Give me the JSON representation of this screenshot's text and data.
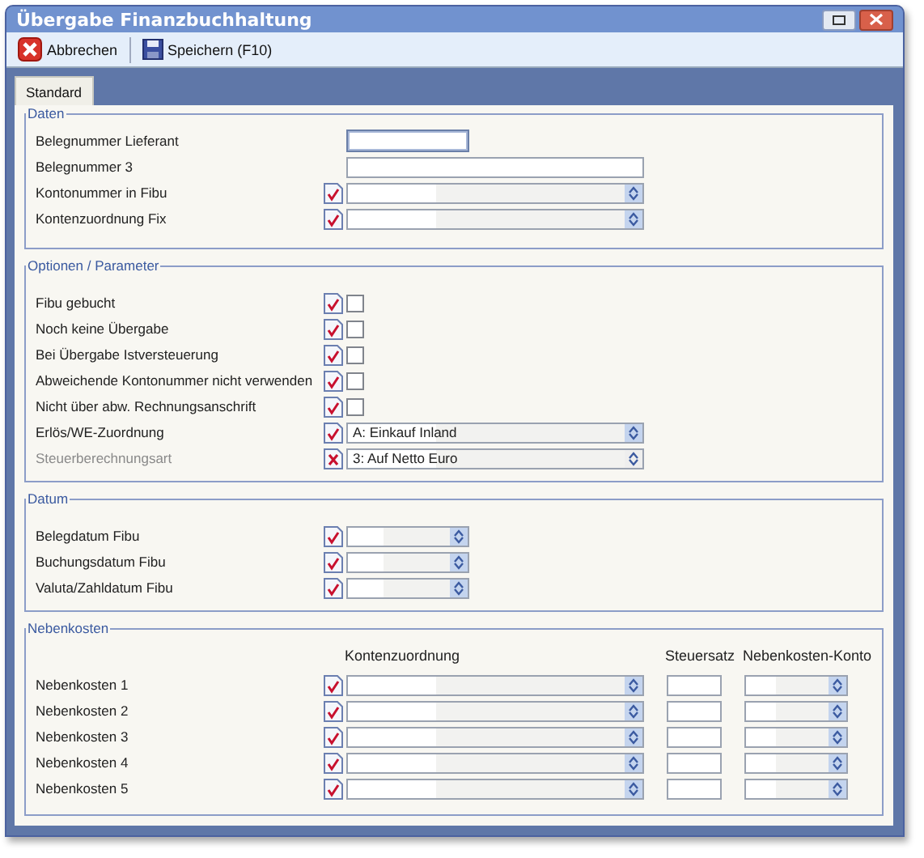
{
  "window": {
    "title": "Übergabe Finanzbuchhaltung"
  },
  "toolbar": [
    {
      "kind": "cancel",
      "label": "Abbrechen"
    },
    {
      "kind": "save",
      "label": "Speichern (F10)"
    }
  ],
  "tabs": [
    {
      "label": "Standard",
      "selected": true
    }
  ],
  "sections": [
    {
      "title": "Daten",
      "rows": [
        {
          "label": "Belegnummer Lieferant",
          "kind": "short-text",
          "focused": true
        },
        {
          "label": "Belegnummer 3",
          "kind": "text",
          "focused": false
        },
        {
          "label": "Kontonummer in Fibu",
          "kind": "combo",
          "valid": true
        },
        {
          "label": "Kontenzuordnung Fix",
          "kind": "combo",
          "valid": true
        }
      ]
    },
    {
      "title": "Optionen / Parameter",
      "rows": [
        {
          "label": "Fibu gebucht",
          "kind": "check",
          "valid": true,
          "checked": false
        },
        {
          "label": "Noch keine Übergabe",
          "kind": "check",
          "valid": true,
          "checked": false
        },
        {
          "label": "Bei Übergabe Istversteuerung",
          "kind": "check",
          "valid": true,
          "checked": false
        },
        {
          "label": "Abweichende Kontonummer nicht verwenden",
          "kind": "check",
          "valid": true,
          "checked": false
        },
        {
          "label": "Nicht über abw. Rechnungsanschrift",
          "kind": "check",
          "valid": true,
          "checked": false
        },
        {
          "label": "Erlös/WE-Zuordnung",
          "kind": "combo",
          "valid": true,
          "value": "A: Einkauf Inland",
          "disabled": false
        },
        {
          "label": "Steuerberechnungsart",
          "kind": "combo",
          "valid": false,
          "value": "3: Auf Netto Euro",
          "disabled": true
        }
      ]
    },
    {
      "title": "Datum",
      "rows": [
        {
          "label": "Belegdatum Fibu",
          "kind": "date",
          "valid": true
        },
        {
          "label": "Buchungsdatum Fibu",
          "kind": "date",
          "valid": true
        },
        {
          "label": "Valuta/Zahldatum Fibu",
          "kind": "date",
          "valid": true
        }
      ]
    }
  ],
  "nebenkosten": {
    "title": "Nebenkosten",
    "columns": [
      "Kontenzuordnung",
      "Steuersatz",
      "Nebenkosten-Konto"
    ],
    "rows": [
      {
        "label": "Nebenkosten 1",
        "valid": true
      },
      {
        "label": "Nebenkosten 2",
        "valid": true
      },
      {
        "label": "Nebenkosten 3",
        "valid": true
      },
      {
        "label": "Nebenkosten 4",
        "valid": true
      },
      {
        "label": "Nebenkosten 5",
        "valid": true
      }
    ]
  }
}
